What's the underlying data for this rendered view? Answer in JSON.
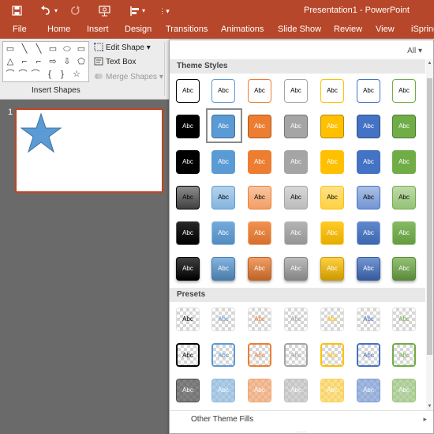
{
  "app": {
    "title": "Presentation1 - PowerPoint",
    "tabs": [
      "File",
      "Home",
      "Insert",
      "Design",
      "Transitions",
      "Animations",
      "Slide Show",
      "Review",
      "View",
      "iSpring"
    ]
  },
  "ribbon": {
    "group_label": "Insert Shapes",
    "edit_shape": "Edit Shape",
    "text_box": "Text Box",
    "merge_shapes": "Merge Shapes",
    "shape_glyphs": [
      "▭",
      "╲",
      "╲",
      "▭",
      "⬭",
      "▭",
      "△",
      "⌐",
      "⌐",
      "⇨",
      "⇩",
      "⬠",
      "⌒",
      "⌒",
      "⌒",
      "{",
      "}",
      "☆"
    ]
  },
  "slides": {
    "number": "1"
  },
  "gallery": {
    "filter": "All",
    "theme_header": "Theme Styles",
    "presets_header": "Presets",
    "tile_label": "Abc",
    "other_fills": "Other Theme Fills",
    "palette": {
      "dark": "#000000",
      "blue": "#5b9bd5",
      "orange": "#ed7d31",
      "gray": "#a5a5a5",
      "gold": "#ffc000",
      "navy": "#4472c4",
      "green": "#70ad47",
      "accent_title": "#b7472a"
    },
    "selected": {
      "row": 1,
      "col": 1
    }
  }
}
